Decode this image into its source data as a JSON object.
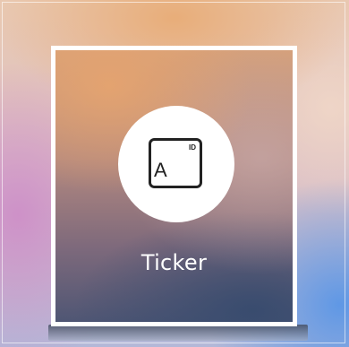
{
  "tile": {
    "label": "Ticker",
    "icon": {
      "name": "ticker-id-key-icon",
      "letter": "A",
      "badge": "ID"
    }
  }
}
